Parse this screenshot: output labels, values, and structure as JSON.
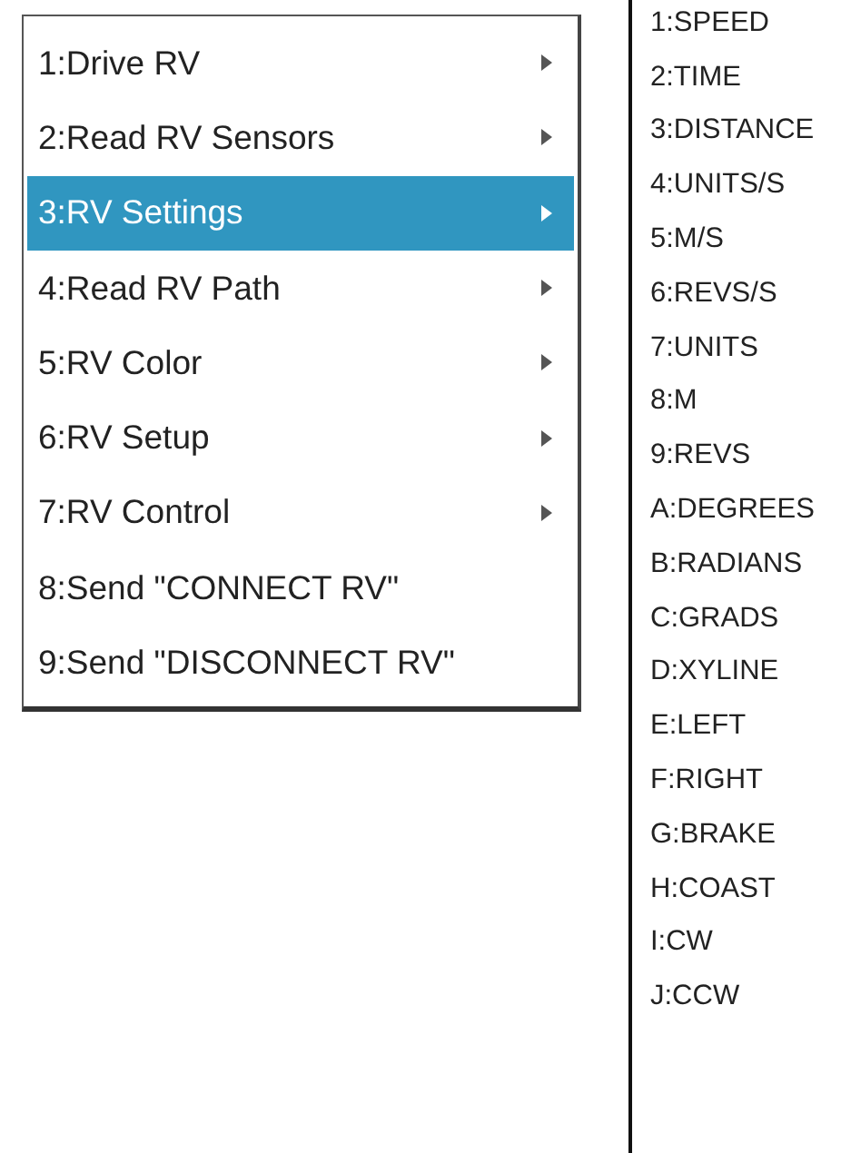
{
  "menu": {
    "items": [
      {
        "label": "1:Drive RV",
        "has_submenu": true,
        "selected": false
      },
      {
        "label": "2:Read RV Sensors",
        "has_submenu": true,
        "selected": false
      },
      {
        "label": "3:RV Settings",
        "has_submenu": true,
        "selected": true
      },
      {
        "label": "4:Read RV Path",
        "has_submenu": true,
        "selected": false
      },
      {
        "label": "5:RV Color",
        "has_submenu": true,
        "selected": false
      },
      {
        "label": "6:RV Setup",
        "has_submenu": true,
        "selected": false
      },
      {
        "label": "7:RV Control",
        "has_submenu": true,
        "selected": false
      },
      {
        "label": "8:Send \"CONNECT RV\"",
        "has_submenu": false,
        "selected": false
      },
      {
        "label": "9:Send \"DISCONNECT RV\"",
        "has_submenu": false,
        "selected": false
      }
    ]
  },
  "submenu": {
    "items": [
      "1:SPEED",
      "2:TIME",
      "3:DISTANCE",
      "4:UNITS/S",
      "5:M/S",
      "6:REVS/S",
      "7:UNITS",
      "8:M",
      "9:REVS",
      "A:DEGREES",
      "B:RADIANS",
      "C:GRADS",
      "D:XYLINE",
      "E:LEFT",
      "F:RIGHT",
      "G:BRAKE",
      "H:COAST",
      "I:CW",
      "J:CCW"
    ]
  }
}
